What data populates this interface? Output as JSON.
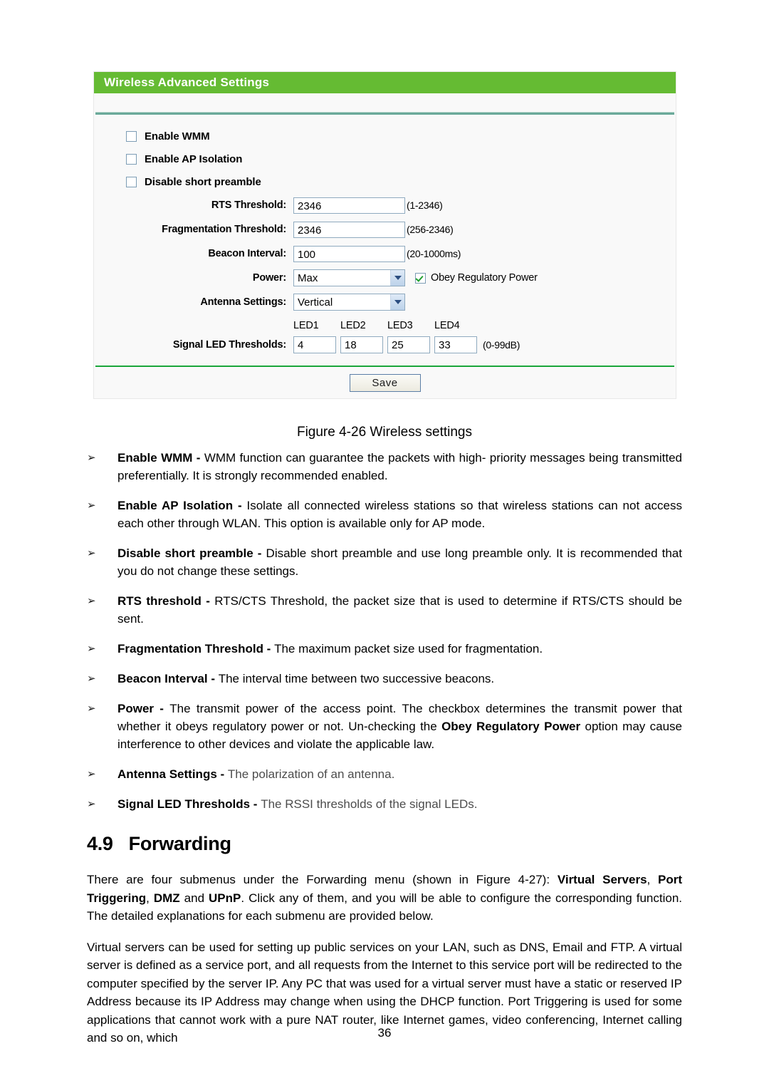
{
  "panel": {
    "header_title": "Wireless Advanced Settings",
    "checkboxes": [
      {
        "label": "Enable WMM",
        "checked": false
      },
      {
        "label": "Enable AP Isolation",
        "checked": false
      },
      {
        "label": "Disable short preamble",
        "checked": false
      }
    ],
    "fields": [
      {
        "label": "RTS Threshold:",
        "value": "2346",
        "hint": "(1-2346)"
      },
      {
        "label": "Fragmentation Threshold:",
        "value": "2346",
        "hint": "(256-2346)"
      },
      {
        "label": "Beacon Interval:",
        "value": "100",
        "hint": "(20-1000ms)"
      }
    ],
    "power": {
      "label": "Power:",
      "selected": "Max",
      "obey_label": "Obey Regulatory Power",
      "obey_checked": true
    },
    "antenna": {
      "label": "Antenna Settings:",
      "selected": "Vertical"
    },
    "led": {
      "label": "Signal LED Thresholds:",
      "headers": [
        "LED1",
        "LED2",
        "LED3",
        "LED4"
      ],
      "values": [
        "4",
        "18",
        "25",
        "33"
      ],
      "hint": "(0-99dB)"
    },
    "save_label": "Save",
    "colors": {
      "header_green": "#65bb33",
      "divider_green": "#1aa63a",
      "divider_teal": "#6aa99a",
      "panel_bg": "#f9f9f9",
      "check_green": "#1f9f2e"
    }
  },
  "caption": "Figure 4-26 Wireless settings",
  "bullets": [
    {
      "marker": "➢",
      "term": "Enable WMM - ",
      "text": "WMM function can guarantee the packets with high- priority messages being transmitted preferentially. It is strongly recommended enabled.",
      "grey": false
    },
    {
      "marker": "➢",
      "term": "Enable AP Isolation - ",
      "text": "Isolate all connected wireless stations so that wireless stations can not access each other through WLAN. This option is available only for AP mode.",
      "grey": false
    },
    {
      "marker": "➢",
      "term": "Disable short preamble - ",
      "text": "Disable short preamble and use long preamble only. It is recommended that you do not change these settings.",
      "grey": false
    },
    {
      "marker": "➢",
      "term": "RTS threshold - ",
      "text": "RTS/CTS Threshold, the packet size that is used to determine if RTS/CTS should be sent.",
      "grey": false
    },
    {
      "marker": "➢",
      "term": "Fragmentation Threshold - ",
      "text": "The maximum packet size used for fragmentation.",
      "grey": false
    },
    {
      "marker": "➢",
      "term": "Beacon Interval - ",
      "text": "The interval time between two successive beacons.",
      "grey": false
    },
    {
      "marker": "➢",
      "term": "Power - ",
      "text": "The transmit power of the access point. The checkbox determines the transmit power that whether it obeys regulatory power or not. Un-checking the ",
      "bold_mid": "Obey Regulatory Power",
      "text2": " option may cause interference to other devices and violate the applicable law.",
      "grey": false
    },
    {
      "marker": "➢",
      "term": "Antenna Settings - ",
      "text": "The polarization of an antenna.",
      "grey": true
    },
    {
      "marker": "➢",
      "term": "Signal LED Thresholds - ",
      "text": "The RSSI thresholds of the signal LEDs.",
      "grey": true
    }
  ],
  "section": {
    "number": "4.9",
    "title": "Forwarding"
  },
  "paragraphs": {
    "p1_a": "There are four submenus under the Forwarding menu (shown in Figure 4-27): ",
    "p1_b1": "Virtual Servers",
    "p1_c": ", ",
    "p1_b2": "Port Triggering",
    "p1_d": ", ",
    "p1_b3": "DMZ",
    "p1_e": " and ",
    "p1_b4": "UPnP",
    "p1_f": ". Click any of them, and you will be able to configure the corresponding function. The detailed explanations for each submenu are provided below.",
    "p2": "Virtual servers can be used for setting up public services on your LAN, such as DNS, Email and FTP. A virtual server is defined as a service port, and all requests from the Internet to this service port will be redirected to the computer specified by the server IP. Any PC that was used for a virtual server must have a static or reserved IP Address because its IP Address may change when using the DHCP function. Port Triggering is used for some applications that cannot work with a pure NAT router, like Internet games, video conferencing, Internet calling and so on, which"
  },
  "page_number": "36"
}
